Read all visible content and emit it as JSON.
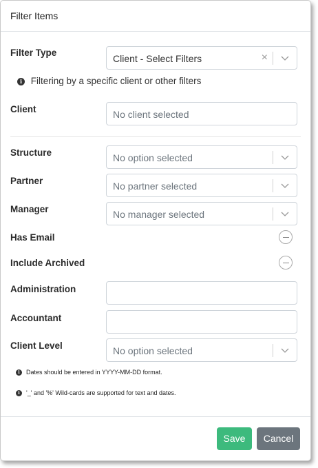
{
  "dialog": {
    "title": "Filter Items"
  },
  "filter_type": {
    "label": "Filter Type",
    "value": "Client - Select Filters",
    "clear_glyph": "×"
  },
  "info": {
    "text": "Filtering by a specific client or other filters",
    "icon": "info-icon"
  },
  "client": {
    "label": "Client",
    "value": "No client selected"
  },
  "structure": {
    "label": "Structure",
    "value": "No option selected"
  },
  "partner": {
    "label": "Partner",
    "value": "No partner selected"
  },
  "manager": {
    "label": "Manager",
    "value": "No manager selected"
  },
  "has_email": {
    "label": "Has Email"
  },
  "include_archived": {
    "label": "Include Archived"
  },
  "administration": {
    "label": "Administration",
    "value": ""
  },
  "accountant": {
    "label": "Accountant",
    "value": ""
  },
  "client_level": {
    "label": "Client Level",
    "value": "No option selected"
  },
  "notes": [
    "Dates should be entered in YYYY-MM-DD format.",
    "'_' and '%' Wild-cards are supported for text and dates."
  ],
  "buttons": {
    "save": "Save",
    "cancel": "Cancel"
  },
  "colors": {
    "save": "#3dba7d",
    "cancel": "#6c757d"
  }
}
